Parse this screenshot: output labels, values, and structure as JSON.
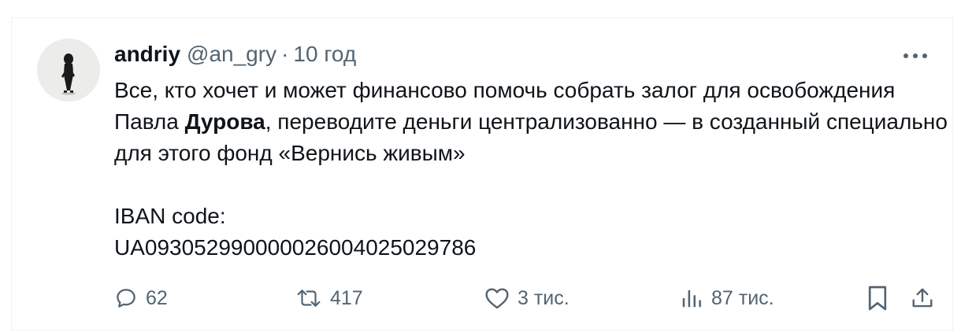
{
  "tweet": {
    "author_name": "andriy",
    "handle": "@an_gry",
    "separator": "·",
    "time": "10 год",
    "text_line1_prefix": "Все, кто хочет и может финансово помочь собрать залог для освобождения Павла ",
    "text_bold": "Дурова",
    "text_line1_suffix": ", переводите деньги централизованно — в созданный специально для этого фонд «Вернись живым»",
    "iban_label": "IBAN code:",
    "iban_value": "UA093052990000026004025029786"
  },
  "actions": {
    "replies": "62",
    "reposts": "417",
    "likes": "3 тис.",
    "views": "87 тис."
  },
  "icons": {
    "more": "more-dots-icon",
    "reply": "reply-bubble-icon",
    "repost": "repost-arrows-icon",
    "like": "heart-icon",
    "views": "views-bars-icon",
    "bookmark": "bookmark-icon",
    "share": "share-upload-icon"
  },
  "colors": {
    "text": "#0f1419",
    "secondary": "#536471",
    "border": "#eff3f4"
  }
}
